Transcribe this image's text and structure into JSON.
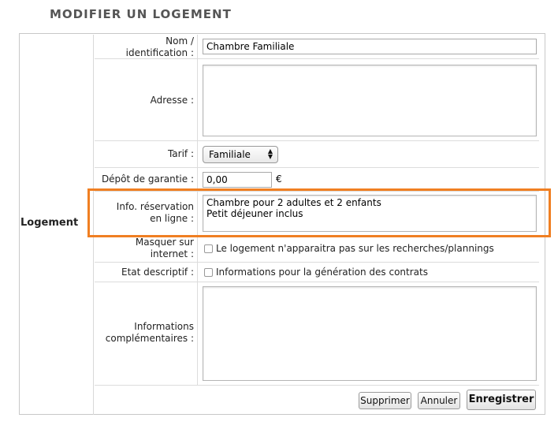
{
  "page": {
    "title": "MODIFIER UN LOGEMENT"
  },
  "section": {
    "label": "Logement"
  },
  "form": {
    "nom_label_line1": "Nom /",
    "nom_label_line2": "identification :",
    "nom_value": "Chambre Familiale",
    "adresse_label": "Adresse :",
    "adresse_value": "",
    "tarif_label": "Tarif :",
    "tarif_selected": "Familiale",
    "depot_label": "Dépôt de garantie :",
    "depot_value": "0,00",
    "depot_unit": "€",
    "info_label_line1": "Info. réservation",
    "info_label_line2": "en ligne :",
    "info_value": "Chambre pour 2 adultes et 2 enfants\nPetit déjeuner inclus",
    "masquer_label_line1": "Masquer sur",
    "masquer_label_line2": "internet :",
    "masquer_checkbox_text": "Le logement n'apparaitra pas sur les recherches/plannings",
    "etat_label": "Etat descriptif :",
    "etat_checkbox_text": "Informations pour la génération des contrats",
    "infos_comp_label_line1": "Informations",
    "infos_comp_label_line2": "complémentaires :",
    "infos_comp_value": ""
  },
  "actions": {
    "supprimer": "Supprimer",
    "annuler": "Annuler",
    "enregistrer": "Enregistrer"
  },
  "colors": {
    "highlight": "#f07f22",
    "title": "#555555"
  },
  "icons": {
    "select_arrows": "updown-arrows-icon"
  }
}
